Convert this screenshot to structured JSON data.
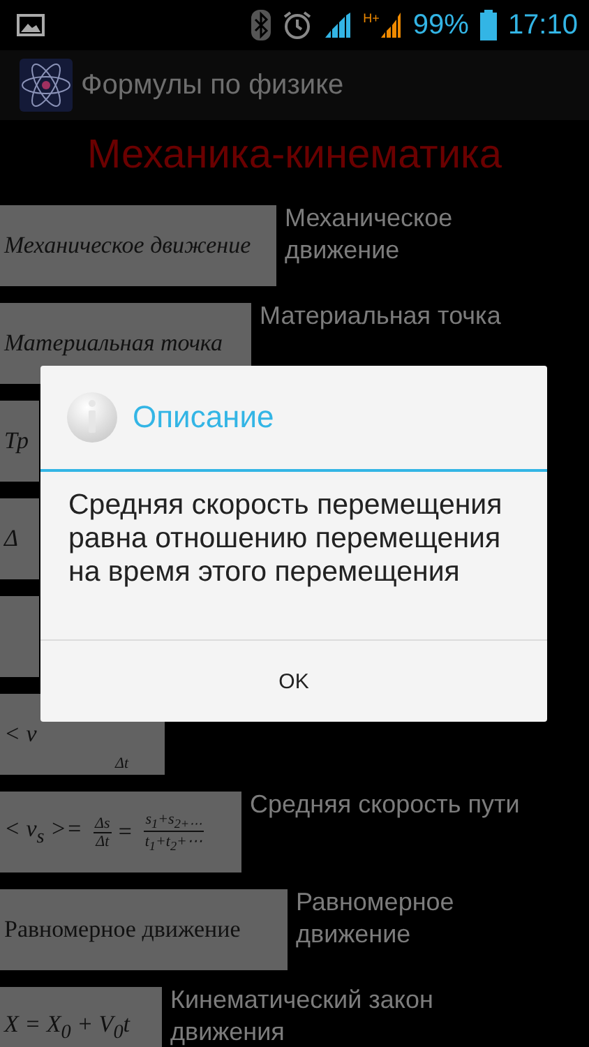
{
  "status_bar": {
    "network_type": "H+",
    "battery": "99%",
    "time": "17:10"
  },
  "app_bar": {
    "title": "Формулы по физике"
  },
  "heading": "Механика-кинематика",
  "rows": [
    {
      "kind": "italic_text",
      "formula": "Механическое движение",
      "label": "Механическое движение"
    },
    {
      "kind": "italic_text",
      "formula": "Материальная точка",
      "label": "Материальная точка"
    },
    {
      "kind": "italic_text",
      "formula": "Тр"
    },
    {
      "kind": "italic_text",
      "formula": "Δ"
    },
    {
      "kind": "blank"
    },
    {
      "kind": "partial_fraction",
      "formula": "< v",
      "denominator": "Δt"
    },
    {
      "kind": "fraction_formula",
      "lead": "< v$_{s}$ >=",
      "fractions": [
        {
          "num": "Δs",
          "den": "Δt"
        },
        {
          "sep": "=",
          "num": "s$_{1}$+s$_{2+⋯}$",
          "den": "t$_{1}$+t$_{2}$+⋯"
        }
      ],
      "label": "Средняя скорость пути"
    },
    {
      "kind": "text",
      "formula": "Равномерное движение",
      "label": "Равномерное движение"
    },
    {
      "kind": "italic_text",
      "formula": "X = X$_{0}$ + V$_{0}$t",
      "label": "Кинематический закон движения"
    }
  ],
  "dialog": {
    "title": "Описание",
    "message": "Средняя скорость перемещения равна отношению перемещения на время этого перемещения",
    "buttons": [
      "OK"
    ]
  }
}
